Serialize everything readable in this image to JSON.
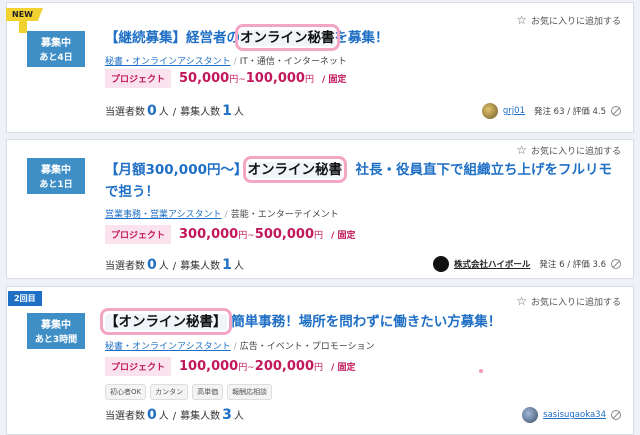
{
  "fav_label": "お気に入りに追加する",
  "price_tag": "プロジェクト",
  "yen": "円",
  "tilde": "~",
  "fixed": "/ 固定",
  "selected_label": "当選者数",
  "recruit_label": "募集人数",
  "person": "人",
  "colors": {
    "accent_blue": "#1f6fc5",
    "badge_blue": "#3f8fc6",
    "price_pink": "#c2185b",
    "highlight_circle": "#f2a6c3"
  },
  "cards": [
    {
      "flag": "NEW",
      "status": "募集中",
      "remaining": "あと4日",
      "title_pre": "【継続募集】経営者の",
      "title_hl": "オンライン秘書",
      "title_post": "を募集！",
      "cat_main": "秘書・オンラインアシスタント",
      "cat_sub": "IT・通信・インターネット",
      "price_min": "50,000",
      "price_max": "100,000",
      "selected": "0",
      "recruit": "1",
      "client": "grj01",
      "stats": "発注 63 / 評価 4.5"
    },
    {
      "status": "募集中",
      "remaining": "あと1日",
      "title_pre": "【月額300,000円〜】",
      "title_hl": "オンライン秘書",
      "title_post": "！社長・役員直下で組織立ち上げをフルリモで担う！",
      "cat_main": "営業事務・営業アシスタント",
      "cat_sub": "芸能・エンターテイメント",
      "price_min": "300,000",
      "price_max": "500,000",
      "selected": "0",
      "recruit": "1",
      "client": "株式会社ハイボール",
      "stats": "発注 6 / 評価 3.6"
    },
    {
      "flag": "2回目",
      "status": "募集中",
      "remaining": "あと3時間",
      "title_pre": "",
      "title_hl": "【オンライン秘書】",
      "title_post": "簡単事務！場所を問わずに働きたい方募集！",
      "cat_main": "秘書・オンラインアシスタント",
      "cat_sub": "広告・イベント・プロモーション",
      "price_min": "100,000",
      "price_max": "200,000",
      "tags": [
        "初心者OK",
        "カンタン",
        "高単価",
        "報酬応相談"
      ],
      "selected": "0",
      "recruit": "3",
      "client": "sasisugaoka34"
    }
  ]
}
